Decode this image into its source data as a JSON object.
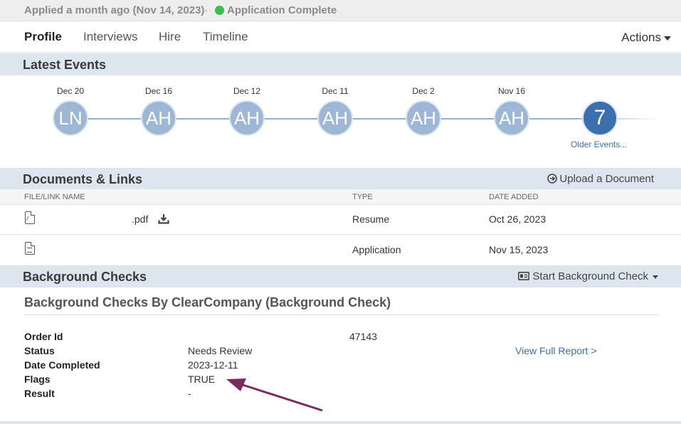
{
  "topbar": {
    "applied": "Applied a month ago (Nov 14, 2023)",
    "separator": "·",
    "status": "Application Complete",
    "status_color": "#3cbf4d"
  },
  "nav": {
    "tabs": [
      {
        "label": "Profile",
        "active": true
      },
      {
        "label": "Interviews",
        "active": false
      },
      {
        "label": "Hire",
        "active": false
      },
      {
        "label": "Timeline",
        "active": false
      }
    ],
    "actions_label": "Actions"
  },
  "latest_events": {
    "title": "Latest Events",
    "events": [
      {
        "date": "Dec 20",
        "initials": "LN"
      },
      {
        "date": "Dec 16",
        "initials": "AH"
      },
      {
        "date": "Dec 12",
        "initials": "AH"
      },
      {
        "date": "Dec 11",
        "initials": "AH"
      },
      {
        "date": "Dec 2",
        "initials": "AH"
      },
      {
        "date": "Nov 16",
        "initials": "AH"
      }
    ],
    "older_count": "7",
    "older_label": "Older Events..."
  },
  "documents": {
    "title": "Documents & Links",
    "upload_label": "Upload a Document",
    "columns": [
      "FILE/LINK NAME",
      "TYPE",
      "DATE ADDED"
    ],
    "rows": [
      {
        "name": ".pdf",
        "icon": "file-pdf-icon",
        "type": "Resume",
        "date": "Oct 26, 2023"
      },
      {
        "name": "",
        "icon": "file-text-icon",
        "type": "Application",
        "date": "Nov 15, 2023"
      }
    ]
  },
  "background_checks": {
    "title": "Background Checks",
    "start_label": "Start Background Check",
    "provider_title": "Background Checks By ClearCompany (Background Check)",
    "fields": {
      "order_id_label": "Order Id",
      "order_id_value": "47143",
      "status_label": "Status",
      "status_value": "Needs Review",
      "date_label": "Date Completed",
      "date_value": "2023-12-11",
      "flags_label": "Flags",
      "flags_value": "TRUE",
      "result_label": "Result",
      "result_value": "-"
    },
    "report_link": "View Full Report >"
  },
  "colors": {
    "accent": "#3d6fa8",
    "section_bg": "#dde6ee",
    "avatar": "#9db7d4",
    "count_avatar": "#3b6fad",
    "annotation_arrow": "#7a2b5c"
  }
}
